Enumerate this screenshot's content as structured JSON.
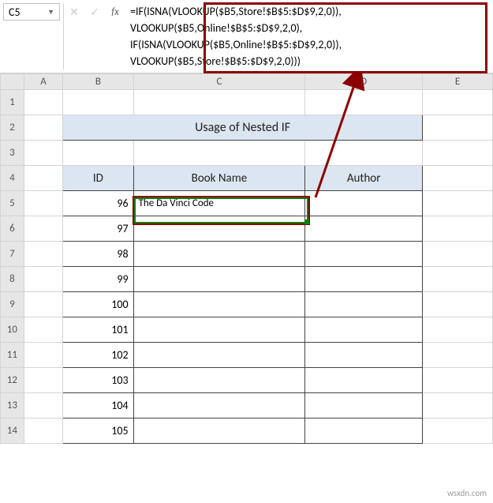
{
  "name_box": "C5",
  "formula_lines": [
    "=IF(ISNA(VLOOKUP($B5,Store!$B$5:$D$9,2,0)),",
    "VLOOKUP($B5,Online!$B$5:$D$9,2,0),",
    "IF(ISNA(VLOOKUP($B5,Online!$B$5:$D$9,2,0)),",
    "VLOOKUP($B5,Store!$B$5:$D$9,2,0)))"
  ],
  "columns": [
    "A",
    "B",
    "C",
    "D",
    "E"
  ],
  "rows": [
    "1",
    "2",
    "3",
    "4",
    "5",
    "6",
    "7",
    "8",
    "9",
    "10",
    "11",
    "12",
    "13",
    "14"
  ],
  "title": "Usage of Nested IF",
  "headers": {
    "id": "ID",
    "book": "Book Name",
    "author": "Author"
  },
  "table": [
    {
      "id": "96",
      "book": "The Da Vinci Code",
      "author": ""
    },
    {
      "id": "97",
      "book": "",
      "author": ""
    },
    {
      "id": "98",
      "book": "",
      "author": ""
    },
    {
      "id": "99",
      "book": "",
      "author": ""
    },
    {
      "id": "100",
      "book": "",
      "author": ""
    },
    {
      "id": "101",
      "book": "",
      "author": ""
    },
    {
      "id": "102",
      "book": "",
      "author": ""
    },
    {
      "id": "103",
      "book": "",
      "author": ""
    },
    {
      "id": "104",
      "book": "",
      "author": ""
    },
    {
      "id": "105",
      "book": "",
      "author": ""
    }
  ],
  "watermark": "wsxdn.com"
}
